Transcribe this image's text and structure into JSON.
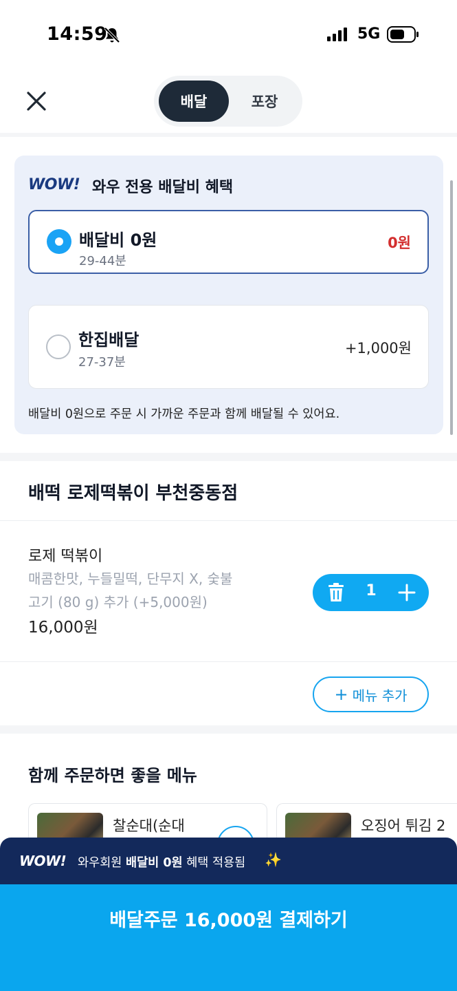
{
  "status_bar": {
    "time": "14:59",
    "network": "5G"
  },
  "header": {
    "tabs": [
      {
        "label": "배달",
        "active": true
      },
      {
        "label": "포장",
        "active": false
      }
    ]
  },
  "wow_benefit": {
    "logo": "WOW!",
    "title": "와우 전용 배달비 혜택",
    "options": [
      {
        "name": "배달비 0원",
        "time": "29-44분",
        "price": "0원",
        "selected": true
      },
      {
        "name": "한집배달",
        "time": "27-37분",
        "price": "+1,000원",
        "selected": false
      }
    ],
    "note": "배달비 0원으로 주문 시 가까운 주문과 함께 배달될 수 있어요."
  },
  "store": {
    "name": "배떡 로제떡볶이 부천중동점"
  },
  "cart_item": {
    "name": "로제 떡볶이",
    "options_line1": "매콤한맛, 누들밀떡, 단무지 X, 숯불",
    "options_line2": "고기 (80 g) 추가 (+5,000원)",
    "price": "16,000원",
    "quantity": "1"
  },
  "add_menu": {
    "plus": "+",
    "label": "메뉴 추가"
  },
  "recommendations": {
    "title": "함께 주문하면 좋을 메뉴",
    "items": [
      {
        "name": "찰순대(순대"
      },
      {
        "name": "오징어 튀김 2"
      }
    ]
  },
  "bottom_banner": {
    "logo": "WOW!",
    "text_prefix": "와우회원 ",
    "text_bold": "배달비 0원",
    "text_suffix": " 혜택 적용됨",
    "sparkle": "✨"
  },
  "pay_button": {
    "label": "배달주문 16,000원 결제하기"
  },
  "colors": {
    "accent": "#0aa6ee",
    "wow_navy": "#13295b",
    "selected_border": "#3a5ea6",
    "price_red": "#d32f2f",
    "card_bg": "#ebf0fa"
  },
  "icons": [
    "bell-slash-icon",
    "signal-icon",
    "battery-icon",
    "close-icon",
    "trash-icon",
    "plus-icon",
    "sparkle-icon"
  ]
}
